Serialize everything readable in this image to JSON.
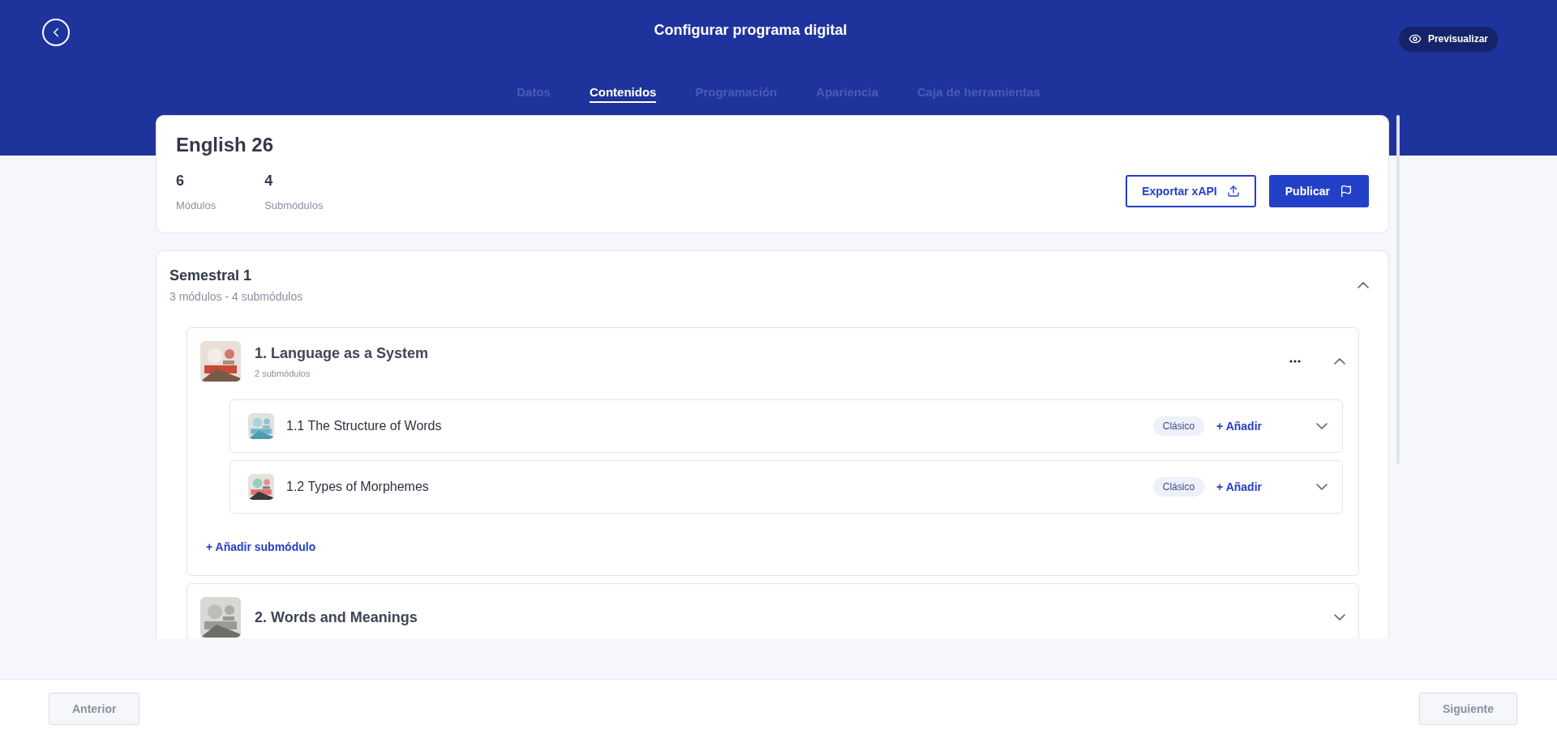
{
  "header": {
    "title": "Configurar programa digital",
    "preview_button": "Previsualizar"
  },
  "tabs": [
    {
      "label": "Datos",
      "selected": false
    },
    {
      "label": "Contenidos",
      "selected": true
    },
    {
      "label": "Programación",
      "selected": false
    },
    {
      "label": "Apariencia",
      "selected": false
    },
    {
      "label": "Caja de herramientas",
      "selected": false
    }
  ],
  "program": {
    "title": "English 26",
    "stats": [
      {
        "value": "6",
        "label": "Módulos"
      },
      {
        "value": "4",
        "label": "Submódulos"
      }
    ],
    "actions": [
      {
        "label": "Exportar xAPI",
        "kind": "outline"
      },
      {
        "label": "Publicar",
        "kind": "primary"
      }
    ]
  },
  "semesters": [
    {
      "title": "Semestral 1",
      "summary": "3 módulos - 4 submódulos",
      "expanded": true,
      "modules": [
        {
          "title": "1. Language as a System",
          "summary": "2 submódulos",
          "expanded": true,
          "add_submodule": "+ Añadir submódulo",
          "submodules": [
            {
              "title": "1.1 The Structure of Words",
              "tag": "Clásico",
              "add": "+ Añadir",
              "expanded": false
            },
            {
              "title": "1.2 Types of Morphemes",
              "tag": "Clásico",
              "add": "+ Añadir",
              "expanded": false
            }
          ]
        },
        {
          "title": "2. Words and Meanings",
          "expanded": false
        }
      ]
    }
  ],
  "footer": {
    "previous": "Anterior",
    "next": "Siguiente"
  }
}
